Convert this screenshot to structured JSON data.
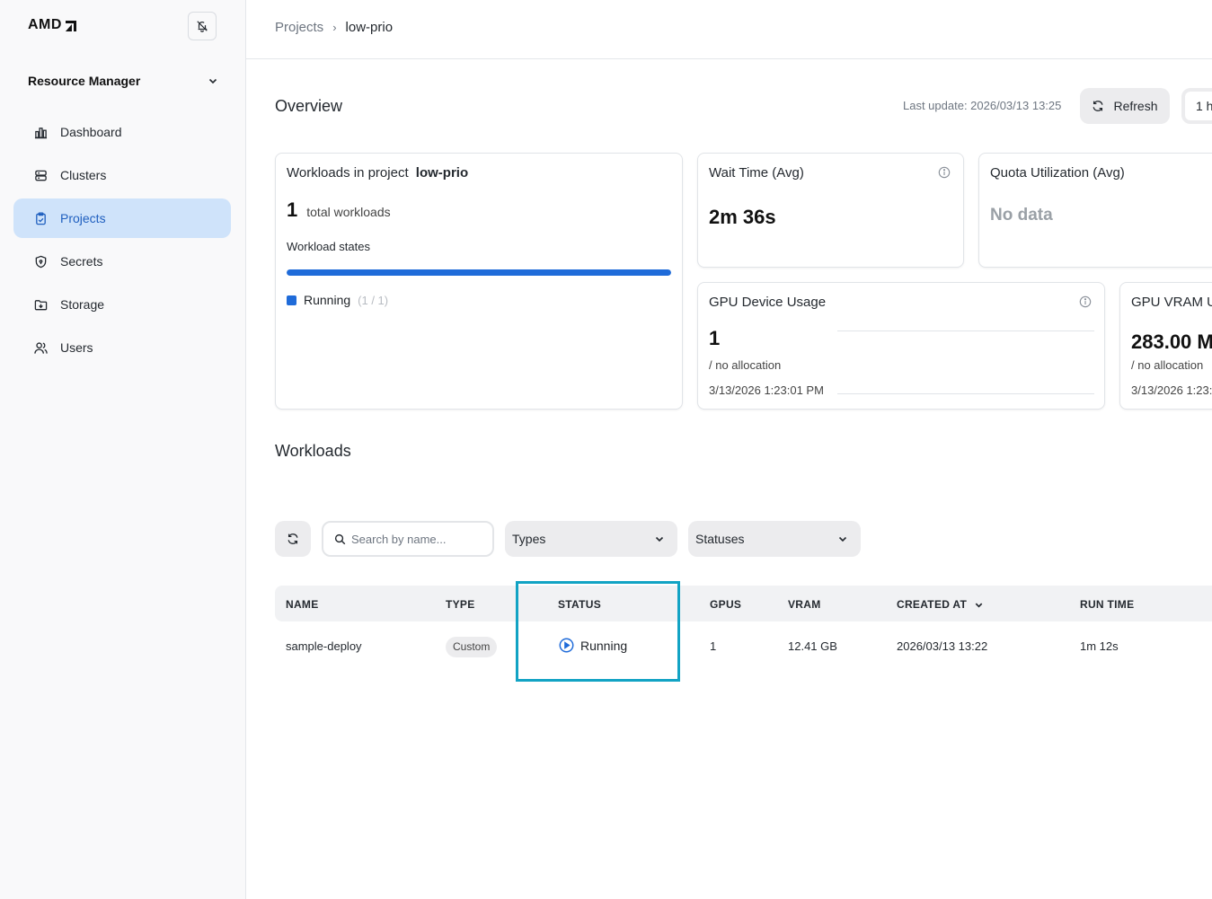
{
  "brand": {
    "logo_text": "AMD"
  },
  "sidebar": {
    "section_title": "Resource Manager",
    "items": [
      {
        "label": "Dashboard",
        "icon": "bar-chart-icon",
        "active": false
      },
      {
        "label": "Clusters",
        "icon": "server-icon",
        "active": false
      },
      {
        "label": "Projects",
        "icon": "clipboard-icon",
        "active": true
      },
      {
        "label": "Secrets",
        "icon": "shield-icon",
        "active": false
      },
      {
        "label": "Storage",
        "icon": "folder-icon",
        "active": false
      },
      {
        "label": "Users",
        "icon": "users-icon",
        "active": false
      }
    ]
  },
  "breadcrumb": {
    "parent": "Projects",
    "current": "low-prio"
  },
  "overview": {
    "title": "Overview",
    "last_update": "Last update: 2026/03/13 13:25",
    "refresh_label": "Refresh",
    "range_label": "1 h"
  },
  "workloads_card": {
    "title_prefix": "Workloads in project",
    "project_name": "low-prio",
    "total": "1",
    "total_label": "total workloads",
    "states_label": "Workload states",
    "running_fraction": 1.0,
    "legend_label": "Running",
    "legend_count": "(1 / 1)"
  },
  "wait_time": {
    "title": "Wait Time (Avg)",
    "value": "2m 36s"
  },
  "quota": {
    "title": "Quota Utilization (Avg)",
    "value": "No data"
  },
  "gpu_usage": {
    "title": "GPU Device Usage",
    "value": "1",
    "sub": "/ no allocation",
    "timestamp": "3/13/2026 1:23:01 PM"
  },
  "gpu_vram": {
    "title": "GPU VRAM U",
    "value": "283.00 M",
    "sub": "/ no allocation",
    "timestamp": "3/13/2026 1:23:0"
  },
  "workloads": {
    "title": "Workloads",
    "search_placeholder": "Search by name...",
    "types_label": "Types",
    "statuses_label": "Statuses",
    "columns": {
      "name": "NAME",
      "type": "TYPE",
      "status": "STATUS",
      "gpus": "GPUS",
      "vram": "VRAM",
      "created_at": "CREATED AT",
      "run_time": "RUN TIME"
    },
    "rows": [
      {
        "name": "sample-deploy",
        "type": "Custom",
        "status": "Running",
        "gpus": "1",
        "vram": "12.41 GB",
        "created_at": "2026/03/13 13:22",
        "run_time": "1m 12s"
      }
    ]
  },
  "colors": {
    "accent": "#1f6bd9",
    "active_nav_bg": "#cfe3fa",
    "highlight_border": "#12a3c4"
  }
}
